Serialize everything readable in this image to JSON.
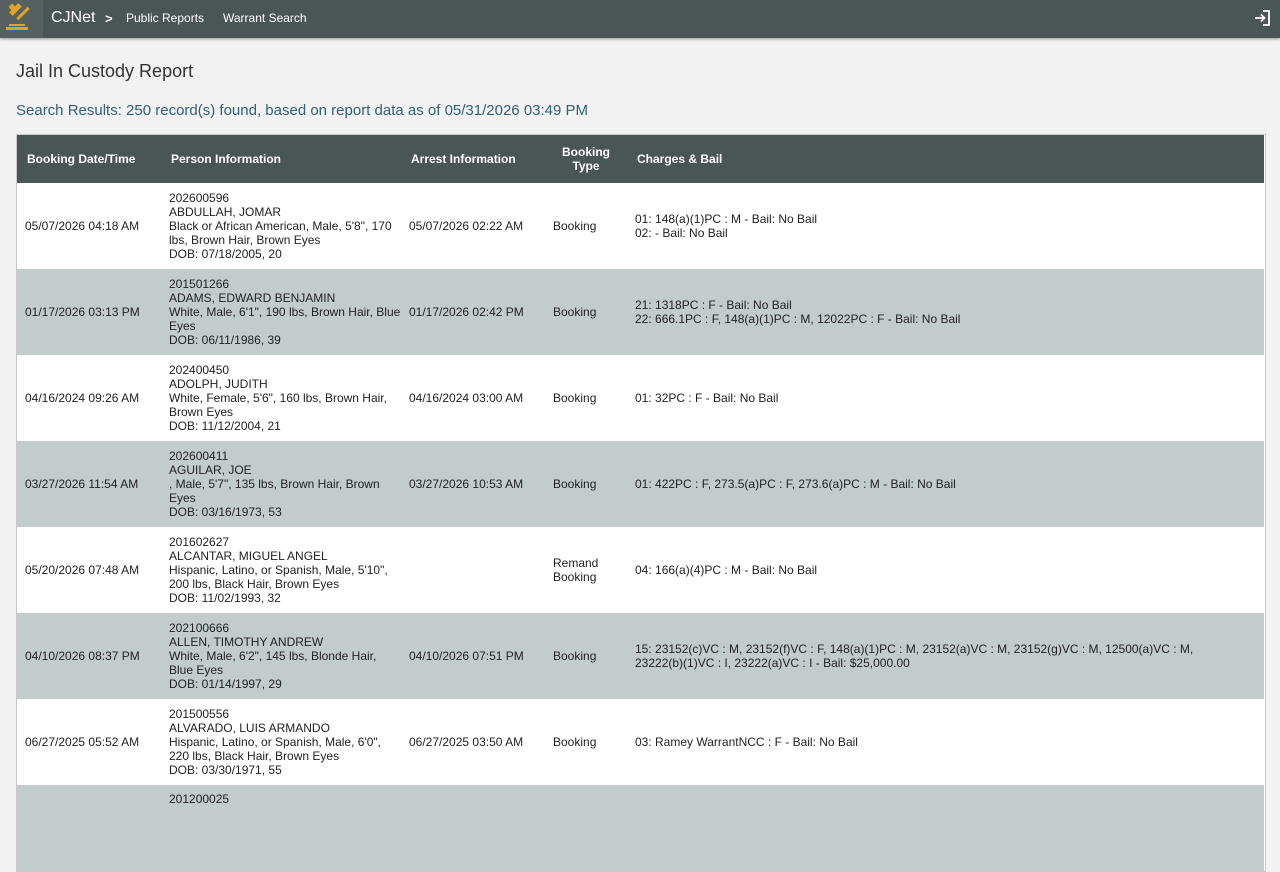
{
  "header": {
    "brand": "CJNet",
    "breadcrumb_separator": ">",
    "nav": [
      "Public Reports",
      "Warrant Search"
    ],
    "logo_icon": "gavel-logo-icon",
    "logout_icon": "logout-icon",
    "colors": {
      "bar": "#4a5656",
      "logo_accent": "#e0a32a"
    }
  },
  "page": {
    "title": "Jail In Custody Report",
    "results_text": "Search Results: 250 record(s) found, based on report data as of 05/31/2026 03:49 PM"
  },
  "table": {
    "columns": [
      "Booking Date/Time",
      "Person Information",
      "Arrest Information",
      "Booking Type",
      "Charges & Bail"
    ],
    "rows": [
      {
        "booking": "05/07/2026 04:18 AM",
        "person": [
          "202600596",
          "ABDULLAH, JOMAR",
          "Black or African American, Male, 5'8\", 170 lbs, Brown Hair, Brown Eyes",
          "DOB: 07/18/2005, 20"
        ],
        "arrest": "05/07/2026 02:22 AM",
        "type": "Booking",
        "charges": [
          "01: 148(a)(1)PC : M - Bail: No Bail",
          "02: - Bail: No Bail"
        ]
      },
      {
        "booking": "01/17/2026 03:13 PM",
        "person": [
          "201501266",
          "ADAMS, EDWARD BENJAMIN",
          "White, Male, 6'1\", 190 lbs, Brown Hair, Blue Eyes",
          "DOB: 06/11/1986, 39"
        ],
        "arrest": "01/17/2026 02:42 PM",
        "type": "Booking",
        "charges": [
          "21: 1318PC : F - Bail: No Bail",
          "22: 666.1PC : F, 148(a)(1)PC : M, 12022PC : F - Bail: No Bail"
        ]
      },
      {
        "booking": "04/16/2024 09:26 AM",
        "person": [
          "202400450",
          "ADOLPH, JUDITH",
          "White, Female, 5'6\", 160 lbs, Brown Hair, Brown Eyes",
          "DOB: 11/12/2004, 21"
        ],
        "arrest": "04/16/2024 03:00 AM",
        "type": "Booking",
        "charges": [
          "01: 32PC : F - Bail: No Bail"
        ]
      },
      {
        "booking": "03/27/2026 11:54 AM",
        "person": [
          "202600411",
          "AGUILAR, JOE",
          ", Male, 5'7\", 135 lbs, Brown Hair, Brown Eyes",
          "DOB: 03/16/1973, 53"
        ],
        "arrest": "03/27/2026 10:53 AM",
        "type": "Booking",
        "charges": [
          "01: 422PC : F, 273.5(a)PC : F, 273.6(a)PC : M - Bail: No Bail"
        ]
      },
      {
        "booking": "05/20/2026 07:48 AM",
        "person": [
          "201602627",
          "ALCANTAR, MIGUEL ANGEL",
          "Hispanic, Latino, or Spanish, Male, 5'10\", 200 lbs, Black Hair, Brown Eyes",
          "DOB: 11/02/1993, 32"
        ],
        "arrest": "",
        "type": "Remand Booking",
        "charges": [
          "04: 166(a)(4)PC : M - Bail: No Bail"
        ]
      },
      {
        "booking": "04/10/2026 08:37 PM",
        "person": [
          "202100666",
          "ALLEN, TIMOTHY ANDREW",
          "White, Male, 6'2\", 145 lbs, Blonde Hair, Blue Eyes",
          "DOB: 01/14/1997, 29"
        ],
        "arrest": "04/10/2026 07:51 PM",
        "type": "Booking",
        "charges": [
          "15: 23152(c)VC : M, 23152(f)VC : F, 148(a)(1)PC : M, 23152(a)VC : M, 23152(g)VC : M, 12500(a)VC : M, 23222(b)(1)VC : I, 23222(a)VC : I - Bail: $25,000.00"
        ]
      },
      {
        "booking": "06/27/2025 05:52 AM",
        "person": [
          "201500556",
          "ALVARADO, LUIS ARMANDO",
          "Hispanic, Latino, or Spanish, Male, 6'0\", 220 lbs, Black Hair, Brown Eyes",
          "DOB: 03/30/1971, 55"
        ],
        "arrest": "06/27/2025 03:50 AM",
        "type": "Booking",
        "charges": [
          "03: Ramey WarrantNCC : F - Bail: No Bail"
        ]
      },
      {
        "booking": "",
        "person": [
          "201200025",
          "",
          "",
          ""
        ],
        "arrest": "",
        "type": "",
        "charges": []
      }
    ]
  }
}
